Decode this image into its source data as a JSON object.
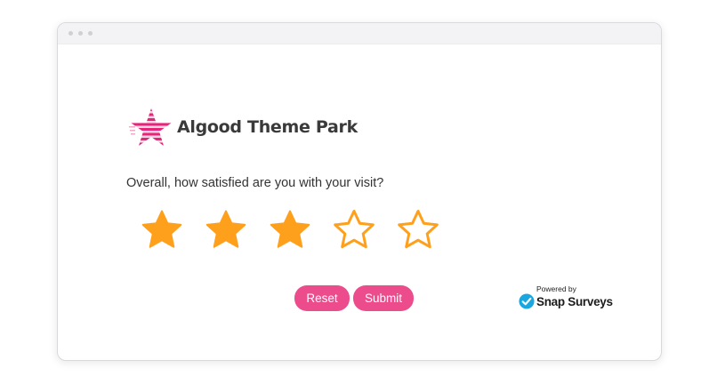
{
  "colors": {
    "accent": "#ec4b8c",
    "star": "#ffa01c",
    "brand_stripe": "#e5247a",
    "snap_check": "#1aa7e0"
  },
  "icons": {
    "brand_logo": "striped-star-logo-icon",
    "star_filled": "star-filled-icon",
    "star_empty": "star-outline-icon",
    "snap_logo": "checkmark-circle-icon"
  },
  "brand": {
    "name": "Algood Theme Park"
  },
  "survey": {
    "question": "Overall, how satisfied are you with your visit?",
    "rating": {
      "value": 3,
      "max": 5
    }
  },
  "actions": {
    "reset_label": "Reset",
    "submit_label": "Submit"
  },
  "footer": {
    "powered_by": "Powered by",
    "provider": "Snap Surveys"
  }
}
